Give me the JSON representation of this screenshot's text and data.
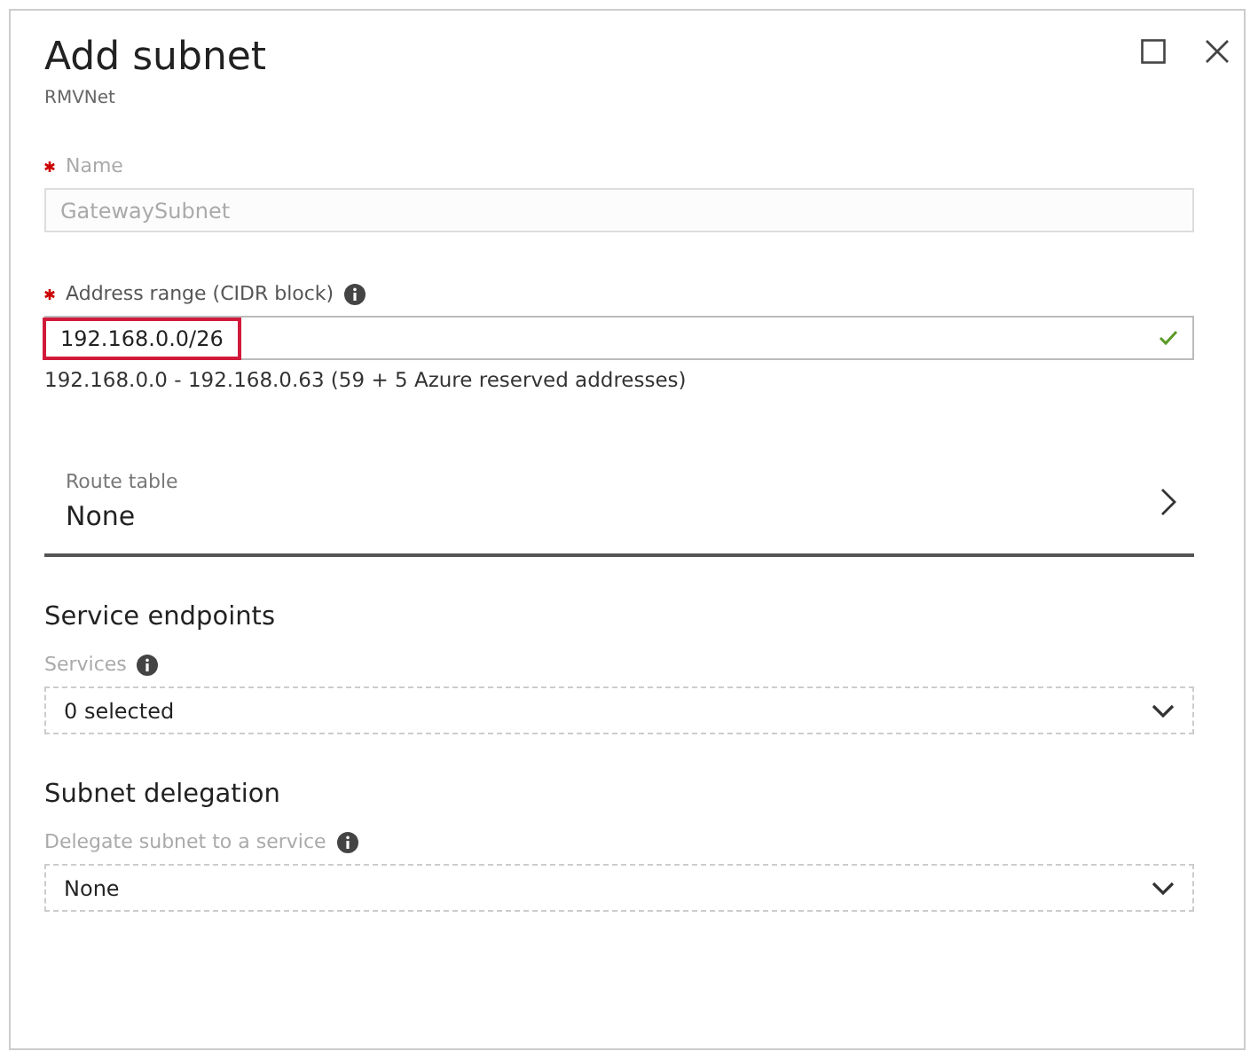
{
  "panel": {
    "title": "Add subnet",
    "subtitle": "RMVNet"
  },
  "name_field": {
    "label": "Name",
    "required": true,
    "info": false,
    "value": "GatewaySubnet",
    "disabled": true
  },
  "address_field": {
    "label": "Address range (CIDR block)",
    "required": true,
    "info": true,
    "value": "192.168.0.0/26",
    "valid": true,
    "highlighted": true,
    "hint": "192.168.0.0 - 192.168.0.63 (59 + 5 Azure reserved addresses)"
  },
  "route_table": {
    "label": "Route table",
    "value": "None"
  },
  "sections": [
    {
      "heading": "Service endpoints",
      "label": "Services",
      "info": true,
      "value": "0 selected"
    },
    {
      "heading": "Subnet delegation",
      "label": "Delegate subnet to a service",
      "info": true,
      "value": "None"
    }
  ]
}
